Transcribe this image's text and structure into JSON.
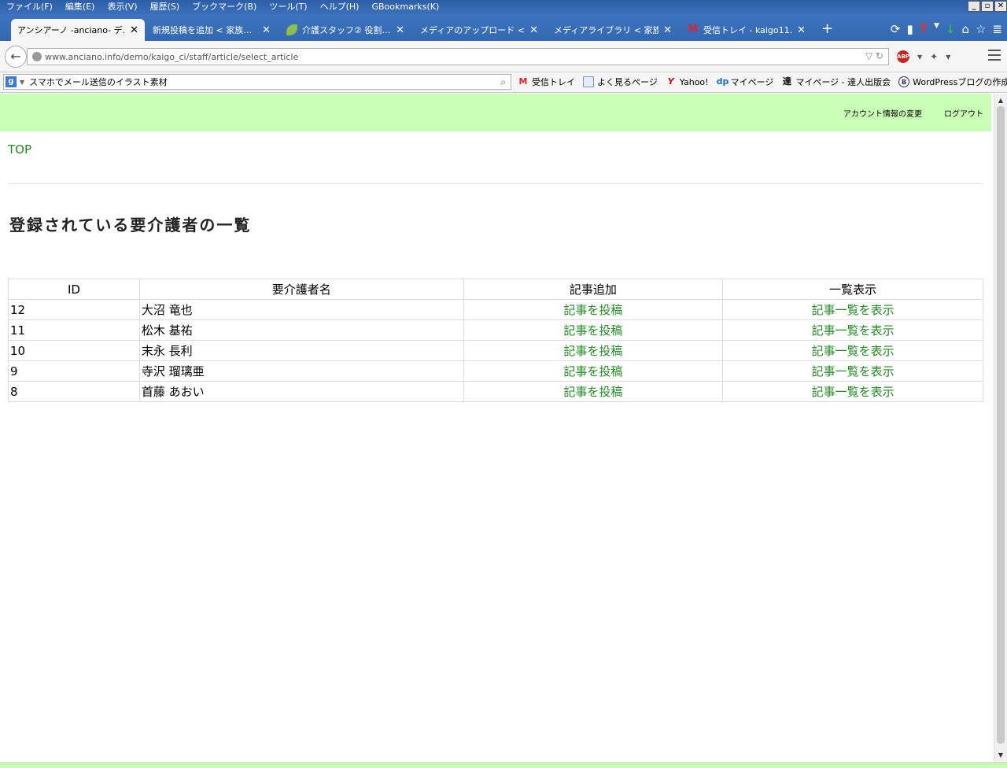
{
  "menubar": {
    "items": [
      "ファイル(F)",
      "編集(E)",
      "表示(V)",
      "履歴(S)",
      "ブックマーク(B)",
      "ツール(T)",
      "ヘルプ(H)",
      "GBookmarks(K)"
    ]
  },
  "tabs": [
    {
      "label": "アンシアーノ -anciano- デ…"
    },
    {
      "label": "新規投稿を追加 < 家族…"
    },
    {
      "label": "介護スタッフ② 役割…"
    },
    {
      "label": "メディアのアップロード < 家…"
    },
    {
      "label": "メディアライブラリ < 家族も…"
    },
    {
      "label": "受信トレイ - kaigo11…"
    }
  ],
  "nav": {
    "url": "www.anciano.info/demo/kaigo_ci/staff/article/select_article"
  },
  "search": {
    "value": "スマホでメール送信のイラスト素材"
  },
  "bookmarks": [
    {
      "label": "受信トレイ",
      "icon": "gmail-icon"
    },
    {
      "label": "よく見るページ",
      "icon": "page-icon"
    },
    {
      "label": "Yahoo!",
      "icon": "yahoo-icon"
    },
    {
      "label": "マイページ",
      "icon": "dp-icon"
    },
    {
      "label": "マイページ - 達人出版会",
      "icon": "tatsujin-icon"
    },
    {
      "label": "WordPressブログの作成…",
      "icon": "blog-icon"
    }
  ],
  "header": {
    "account_link": "アカウント情報の変更",
    "logout_link": "ログアウト"
  },
  "breadcrumb": {
    "top": "TOP"
  },
  "page": {
    "title": "登録されている要介護者の一覧"
  },
  "table": {
    "headers": [
      "ID",
      "要介護者名",
      "記事追加",
      "一覧表示"
    ],
    "rows": [
      {
        "id": "12",
        "name": "大沼 竜也",
        "add": "記事を投稿",
        "list": "記事一覧を表示"
      },
      {
        "id": "11",
        "name": "松木 基祐",
        "add": "記事を投稿",
        "list": "記事一覧を表示"
      },
      {
        "id": "10",
        "name": "末永 長利",
        "add": "記事を投稿",
        "list": "記事一覧を表示"
      },
      {
        "id": "9",
        "name": "寺沢 瑠璃亜",
        "add": "記事を投稿",
        "list": "記事一覧を表示"
      },
      {
        "id": "8",
        "name": "首藤 あおい",
        "add": "記事を投稿",
        "list": "記事一覧を表示"
      }
    ]
  },
  "colors": {
    "header_bg": "#c8ffb4",
    "link": "#228b22"
  }
}
